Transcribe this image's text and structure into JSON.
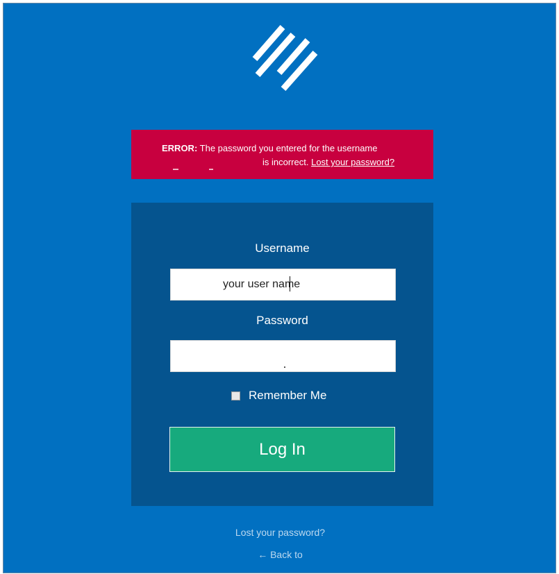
{
  "colors": {
    "background": "#0170c1",
    "error_banner": "#c8003f",
    "panel": "#05548f",
    "login_button": "#17aa7d",
    "link": "#bcd9f0"
  },
  "logo": {
    "icon": "diagonal-stripes-logo"
  },
  "error": {
    "label": "ERROR:",
    "message_part1": "The password you entered for the username",
    "message_part2": "is incorrect.",
    "link_text": "Lost your password?"
  },
  "form": {
    "username_label": "Username",
    "username_value": "your user name",
    "password_label": "Password",
    "password_value": "",
    "remember_label": "Remember Me",
    "remember_checked": false,
    "submit_label": "Log In"
  },
  "footer": {
    "lost_password": "Lost your password?",
    "back_to": "← Back to"
  }
}
